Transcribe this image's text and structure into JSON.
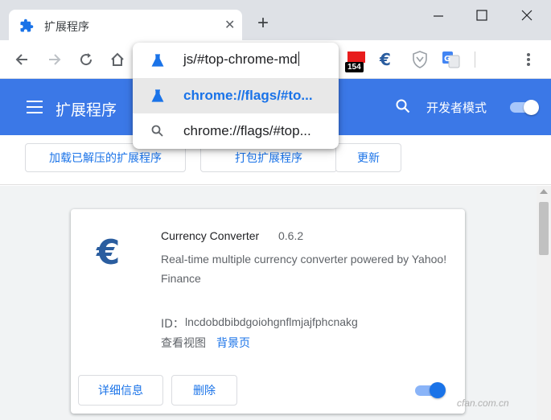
{
  "tab": {
    "title": "扩展程序",
    "icon": "puzzle-icon",
    "close_glyph": "✕"
  },
  "new_tab_glyph": "+",
  "toolbar": {
    "badge_count": "154",
    "icons": [
      "back-icon",
      "forward-icon",
      "reload-icon",
      "home-icon",
      "currency-converter-icon",
      "extension-shield-icon",
      "translate-icon",
      "menu-icon"
    ]
  },
  "omnibox": {
    "input_text": "js/#top-chrome-md",
    "suggestions": [
      {
        "text": "chrome://flags/#to...",
        "icon": "flask-icon"
      },
      {
        "text": "chrome://flags/#top...",
        "icon": "search-icon"
      }
    ]
  },
  "header": {
    "title": "扩展程序",
    "dev_mode_label": "开发者模式",
    "dev_mode_on": true
  },
  "devbar": {
    "load_unpacked": "加载已解压的扩展程序",
    "pack": "打包扩展程序",
    "update": "更新"
  },
  "extension": {
    "name": "Currency Converter",
    "version": "0.6.2",
    "description": "Real-time multiple currency converter powered by Yahoo! Finance",
    "id_label": "ID：",
    "id_value": "lncdobdbibdgoiohgnflmjajfphcnakg",
    "inspect_label": "查看视图",
    "inspect_link": "背景页",
    "details_button": "详细信息",
    "remove_button": "删除",
    "enabled": true
  },
  "watermark": "cfan.com.cn",
  "colors": {
    "accent": "#1a73e8",
    "header": "#3b78e7",
    "tabstrip": "#dee1e6"
  }
}
